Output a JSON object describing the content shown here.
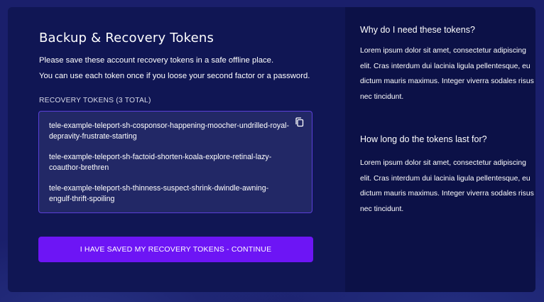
{
  "main": {
    "title": "Backup & Recovery Tokens",
    "description_line1": "Please save these account recovery tokens in a safe offline place.",
    "description_line2": "You can use each token once if you loose your second factor or a password.",
    "tokens_label": "RECOVERY TOKENS (3 TOTAL)",
    "tokens": [
      "tele-example-teleport-sh-cosponsor-happening-moocher-undrilled-royal-depravity-frustrate-starting",
      "tele-example-teleport-sh-factoid-shorten-koala-explore-retinal-lazy-coauthor-brethren",
      "tele-example-teleport-sh-thinness-suspect-shrink-dwindle-awning-engulf-thrift-spoiling"
    ],
    "copy_icon": "copy-icon",
    "continue_label": "I HAVE SAVED MY RECOVERY TOKENS - CONTINUE"
  },
  "faq": [
    {
      "question": "Why do I need these tokens?",
      "answer": "Lorem ipsum dolor sit amet, consectetur adipiscing elit. Cras interdum dui lacinia ligula pellentesque, eu dictum mauris maximus. Integer viverra sodales risus nec tincidunt."
    },
    {
      "question": "How long do the tokens last for?",
      "answer": "Lorem ipsum dolor sit amet, consectetur adipiscing elit. Cras interdum dui lacinia ligula pellentesque, eu dictum mauris maximus. Integer viverra sodales risus nec tincidunt."
    }
  ],
  "colors": {
    "background": "#1a1f6b",
    "card": "#101654",
    "side_panel": "#0c1147",
    "token_box": "#222866",
    "token_border": "#5a3fd8",
    "primary_button": "#6d15f5"
  }
}
